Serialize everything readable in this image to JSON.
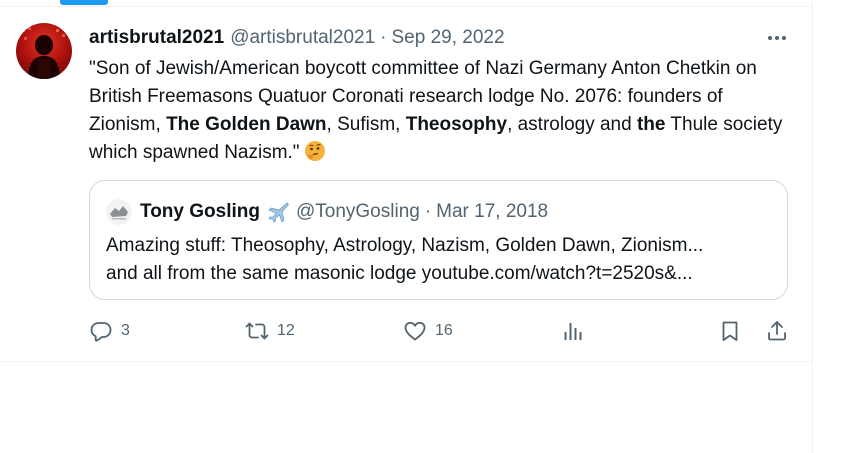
{
  "tweet": {
    "display_name": "artisbrutal2021",
    "handle": "@artisbrutal2021",
    "separator": "·",
    "date": "Sep 29, 2022",
    "text_parts": [
      "\"Son of Jewish/American boycott committee of Nazi Germany Anton Chetkin on British Freemasons Quatuor Coronati research lodge No. 2076: founders of Zionism, ",
      "The Golden Dawn",
      ", Sufism, ",
      "Theosophy",
      ", astrology and ",
      "the",
      " Thule society which spawned Nazism.\""
    ],
    "emoji": "thinking-face"
  },
  "quote": {
    "display_name": "Tony Gosling",
    "badge_emoji": "airplane",
    "handle": "@TonyGosling",
    "separator": "·",
    "date": "Mar 17, 2018",
    "line1": "Amazing stuff: Theosophy, Astrology, Nazism, Golden Dawn, Zionism...",
    "line2": "and all from the same masonic lodge youtube.com/watch?t=2520s&..."
  },
  "actions": {
    "replies": "3",
    "retweets": "12",
    "likes": "16"
  },
  "icons": {
    "more": "more-icon",
    "reply": "reply-icon",
    "retweet": "retweet-icon",
    "like": "heart-icon",
    "views": "analytics-icon",
    "bookmark": "bookmark-icon",
    "share": "share-icon"
  },
  "colors": {
    "accent": "#1d9bf0",
    "text": "#0f1419",
    "muted": "#536471",
    "border": "#cfd9de"
  }
}
